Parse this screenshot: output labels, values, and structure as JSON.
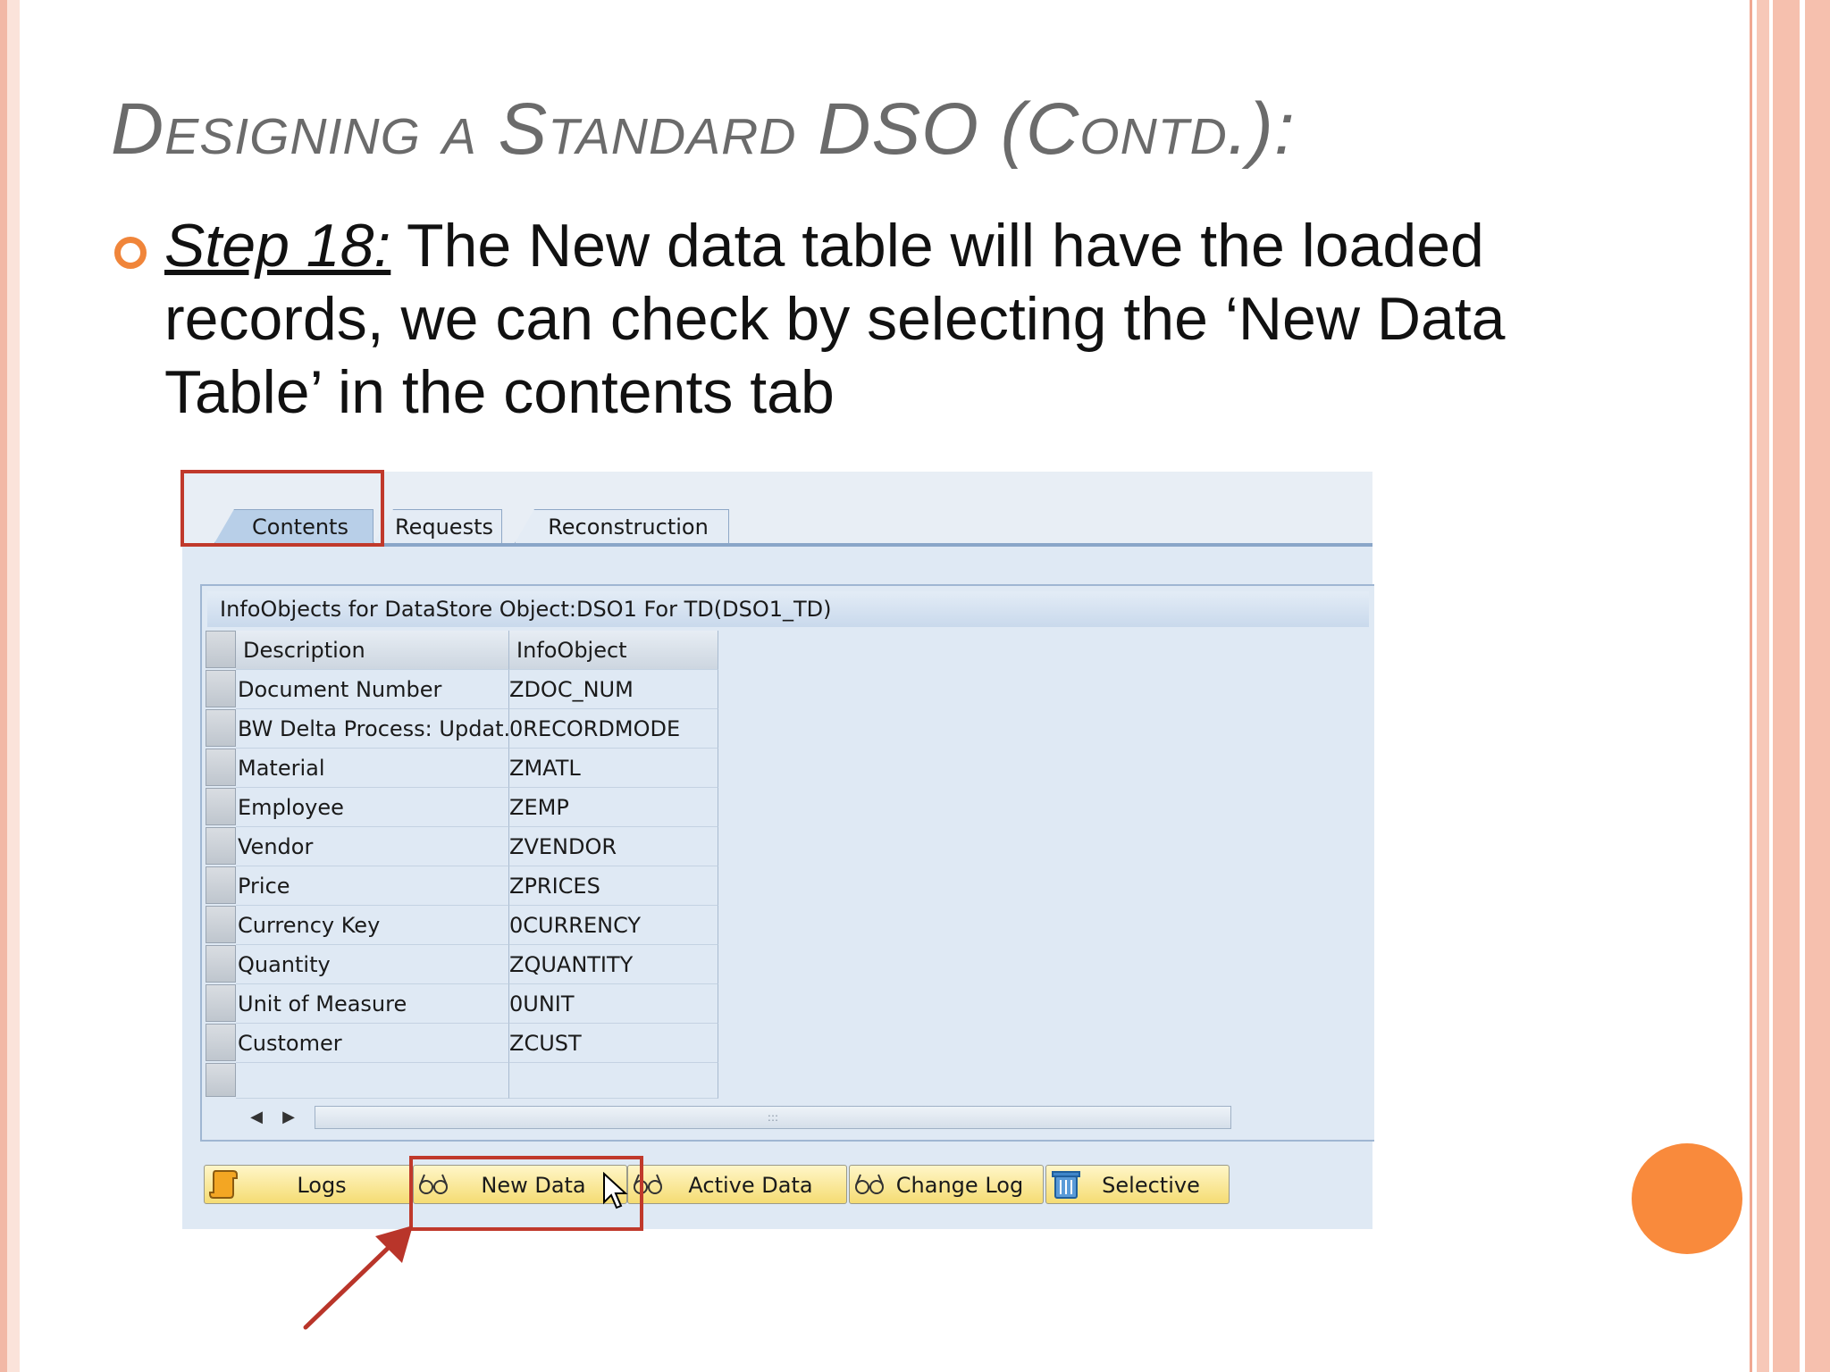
{
  "slide": {
    "title": "Designing a Standard DSO (Contd.):",
    "step_label": "Step 18:",
    "step_text": " The New data table will have the loaded records, we can check by selecting the ‘New Data Table’ in the contents tab"
  },
  "sap": {
    "tabs": [
      "Contents",
      "Requests",
      "Reconstruction"
    ],
    "active_tab": "Contents",
    "panel_title": "InfoObjects for DataStore Object:DSO1 For TD(DSO1_TD)",
    "columns": [
      "Description",
      "InfoObject"
    ],
    "rows": [
      {
        "description": "Document Number",
        "infoobject": "ZDOC_NUM"
      },
      {
        "description": "BW Delta Process: Updat...",
        "infoobject": "0RECORDMODE"
      },
      {
        "description": "Material",
        "infoobject": "ZMATL"
      },
      {
        "description": "Employee",
        "infoobject": "ZEMP"
      },
      {
        "description": "Vendor",
        "infoobject": "ZVENDOR"
      },
      {
        "description": "Price",
        "infoobject": "ZPRICES"
      },
      {
        "description": "Currency Key",
        "infoobject": "0CURRENCY"
      },
      {
        "description": "Quantity",
        "infoobject": "ZQUANTITY"
      },
      {
        "description": "Unit of Measure",
        "infoobject": "0UNIT"
      },
      {
        "description": "Customer",
        "infoobject": "ZCUST"
      }
    ],
    "scroll_grip": ":::",
    "buttons": [
      {
        "label": "Logs",
        "icon": "scroll-icon"
      },
      {
        "label": "New Data",
        "icon": "glasses-icon"
      },
      {
        "label": "Active Data",
        "icon": "glasses-icon"
      },
      {
        "label": "Change Log",
        "icon": "glasses-icon"
      },
      {
        "label": "Selective",
        "icon": "trash-icon"
      }
    ],
    "highlighted": [
      "Contents",
      "New Data"
    ]
  },
  "colors": {
    "title": "#6b6b6b",
    "bullet": "#f0853a",
    "highlight": "#c0392b",
    "button": "#f5dc73",
    "accent_circle": "#f98a3c"
  }
}
